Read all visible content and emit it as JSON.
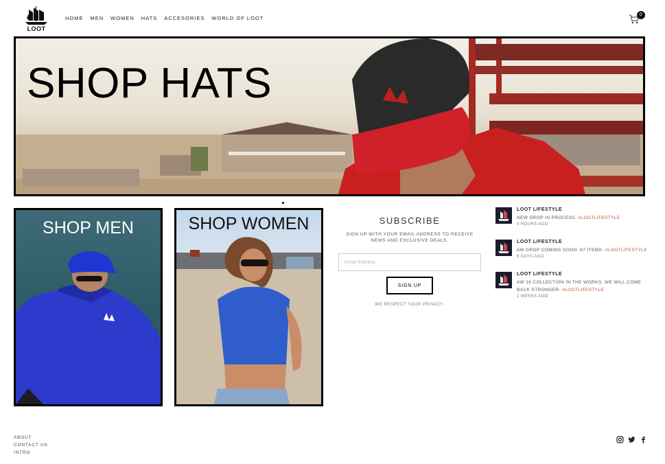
{
  "header": {
    "logo_text": "LOOT",
    "nav": [
      "HOME",
      "MEN",
      "WOMEN",
      "HATS",
      "ACCESORIES",
      "WORLD OF LOOT"
    ],
    "cart_count": "0"
  },
  "hero": {
    "title": "SHOP HATS"
  },
  "tiles": {
    "men": "SHOP MEN",
    "women": "SHOP WOMEN"
  },
  "subscribe": {
    "title": "SUBSCRIBE",
    "text": "SIGN UP WITH YOUR EMAIL ADDRESS TO RECEIVE NEWS AND EXCLUSIVE DEALS.",
    "placeholder": "Email Address",
    "button": "SIGN UP",
    "privacy": "WE RESPECT YOUR PRIVACY."
  },
  "feed": [
    {
      "name": "LOOT LIFESTYLE",
      "text": "NEW DROP IN PROCESS. ",
      "tag": "#LOOTLIFESTYLE",
      "time": "4 HOURS AGO"
    },
    {
      "name": "LOOT LIFESTYLE",
      "text": "AW DROP COMING SOON. 67 ITEMS. ",
      "tag": "#LOOTLIFESTYLE",
      "time": "6 DAYS AGO"
    },
    {
      "name": "LOOT LIFESTYLE",
      "text": "AW 16 COLLECTION IN THE WORKS. WE WILL COME BACK STRONGER. ",
      "tag": "#LOOTLIFESTYLE",
      "time": "2 WEEKS AGO"
    }
  ],
  "footer": {
    "links": [
      "ABOUT",
      "CONTACT US",
      "INTRO"
    ]
  },
  "social": [
    "instagram-icon",
    "twitter-icon",
    "facebook-icon"
  ]
}
